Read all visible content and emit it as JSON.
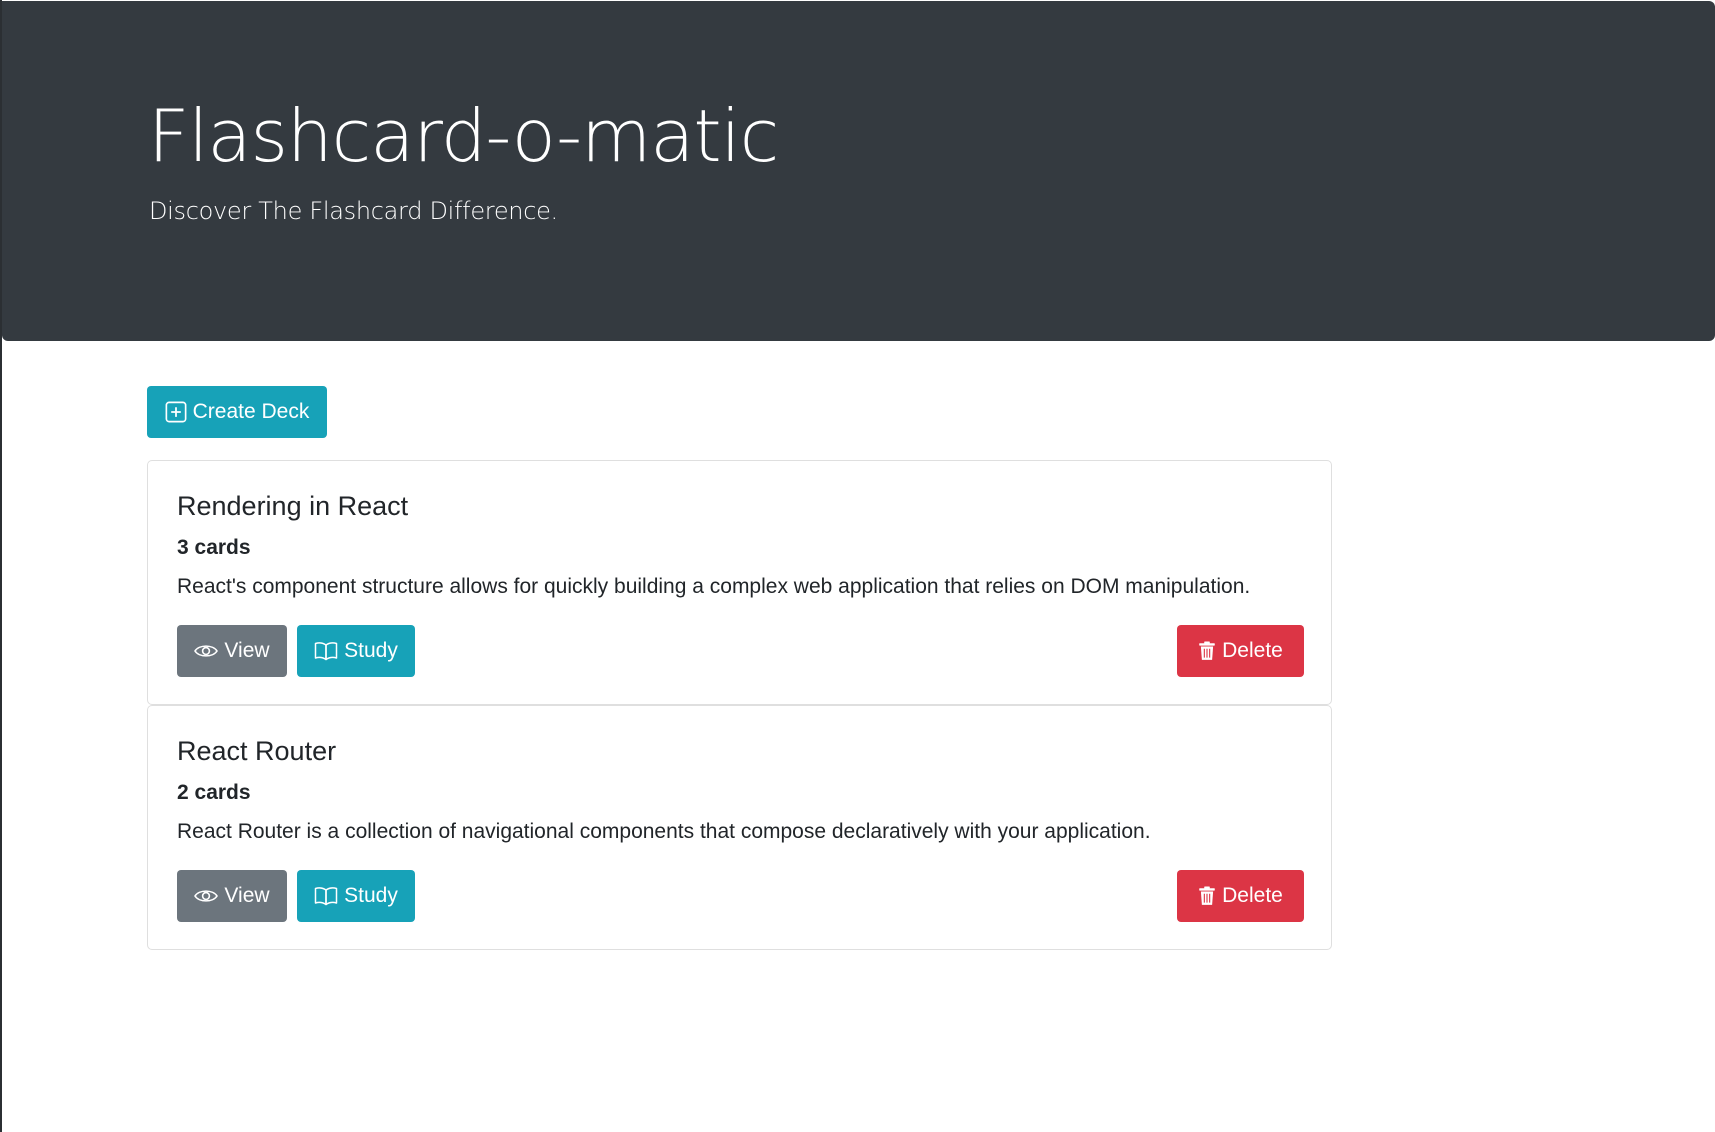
{
  "header": {
    "title": "Flashcard-o-matic",
    "subtitle": "Discover The Flashcard Difference."
  },
  "toolbar": {
    "create_label": "Create Deck",
    "create_icon": "plus-square-icon"
  },
  "decks": [
    {
      "name": "Rendering in React",
      "count": "3 cards",
      "description": "React's component structure allows for quickly building a complex web application that relies on DOM manipulation.",
      "view_label": "View",
      "study_label": "Study",
      "delete_label": "Delete"
    },
    {
      "name": "React Router",
      "count": "2 cards",
      "description": "React Router is a collection of navigational components that compose declaratively with your application.",
      "view_label": "View",
      "study_label": "Study",
      "delete_label": "Delete"
    }
  ],
  "icons": {
    "view": "eye-icon",
    "study": "book-icon",
    "delete": "trash-icon"
  },
  "colors": {
    "header_bg": "#343a40",
    "info": "#17a2b8",
    "secondary": "#6c757d",
    "danger": "#dc3545"
  }
}
